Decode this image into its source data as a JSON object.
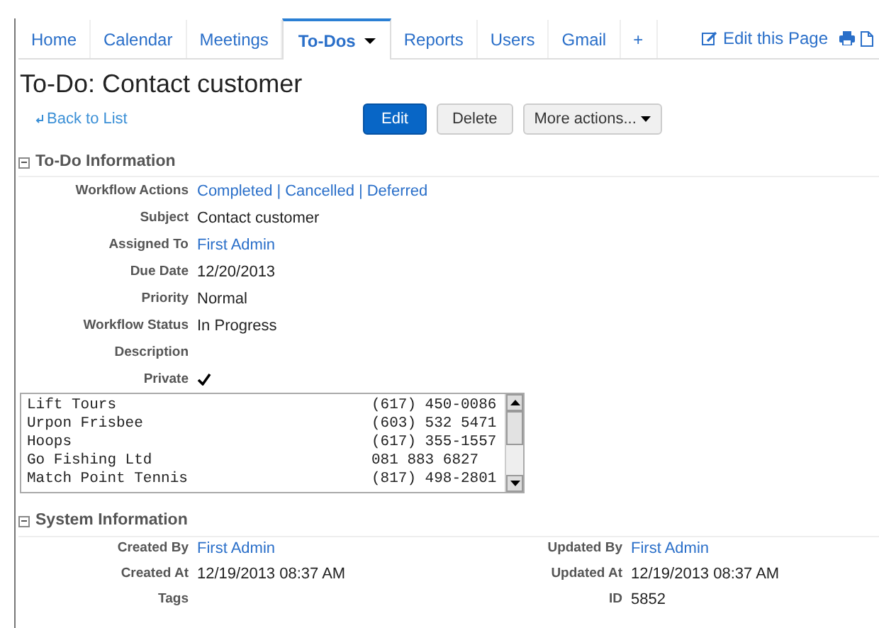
{
  "tabs": [
    {
      "label": "Home",
      "selected": false
    },
    {
      "label": "Calendar",
      "selected": false
    },
    {
      "label": "Meetings",
      "selected": false
    },
    {
      "label": "To-Dos",
      "selected": true,
      "dropdown": true
    },
    {
      "label": "Reports",
      "selected": false
    },
    {
      "label": "Users",
      "selected": false
    },
    {
      "label": "Gmail",
      "selected": false
    },
    {
      "label": "+",
      "selected": false
    }
  ],
  "page_actions": {
    "edit_label": "Edit this Page"
  },
  "title": "To-Do: Contact customer",
  "back_link": "Back to List",
  "buttons": [
    {
      "label": "Edit",
      "kind": "primary"
    },
    {
      "label": "Delete",
      "kind": "default"
    },
    {
      "label": "More actions...",
      "kind": "menu"
    }
  ],
  "todo_section": {
    "title": "To-Do Information",
    "expanded": true,
    "fields": [
      {
        "label": "Workflow Actions",
        "kind": "links",
        "links": [
          "Completed",
          "Cancelled",
          "Deferred"
        ],
        "separator": "|"
      },
      {
        "label": "Subject",
        "kind": "text",
        "value": "Contact customer"
      },
      {
        "label": "Assigned To",
        "kind": "link",
        "value": "First Admin"
      },
      {
        "label": "Due Date",
        "kind": "text",
        "value": "12/20/2013"
      },
      {
        "label": "Priority",
        "kind": "text",
        "value": "Normal"
      },
      {
        "label": "Workflow Status",
        "kind": "text",
        "value": "In Progress"
      },
      {
        "label": "Description",
        "kind": "empty"
      },
      {
        "label": "Private",
        "kind": "check",
        "checked": true
      }
    ]
  },
  "contacts_list": [
    {
      "name": "Lift Tours",
      "phone": "(617) 450-0086"
    },
    {
      "name": "Urpon Frisbee",
      "phone": "(603) 532 5471"
    },
    {
      "name": "Hoops",
      "phone": "(617) 355-1557"
    },
    {
      "name": "Go Fishing Ltd",
      "phone": "081 883 6827"
    },
    {
      "name": "Match Point Tennis",
      "phone": "(817) 498-2801"
    }
  ],
  "system_section": {
    "title": "System Information",
    "expanded": true,
    "fields": [
      {
        "label": "Created By",
        "kind": "link",
        "value": "First Admin"
      },
      {
        "label": "Updated By",
        "kind": "link",
        "value": "First Admin"
      },
      {
        "label": "Created At",
        "kind": "text",
        "value": "12/19/2013 08:37 AM"
      },
      {
        "label": "Updated At",
        "kind": "text",
        "value": "12/19/2013 08:37 AM"
      },
      {
        "label": "Tags",
        "kind": "empty"
      },
      {
        "label": "ID",
        "kind": "text",
        "value": "5852"
      }
    ]
  }
}
